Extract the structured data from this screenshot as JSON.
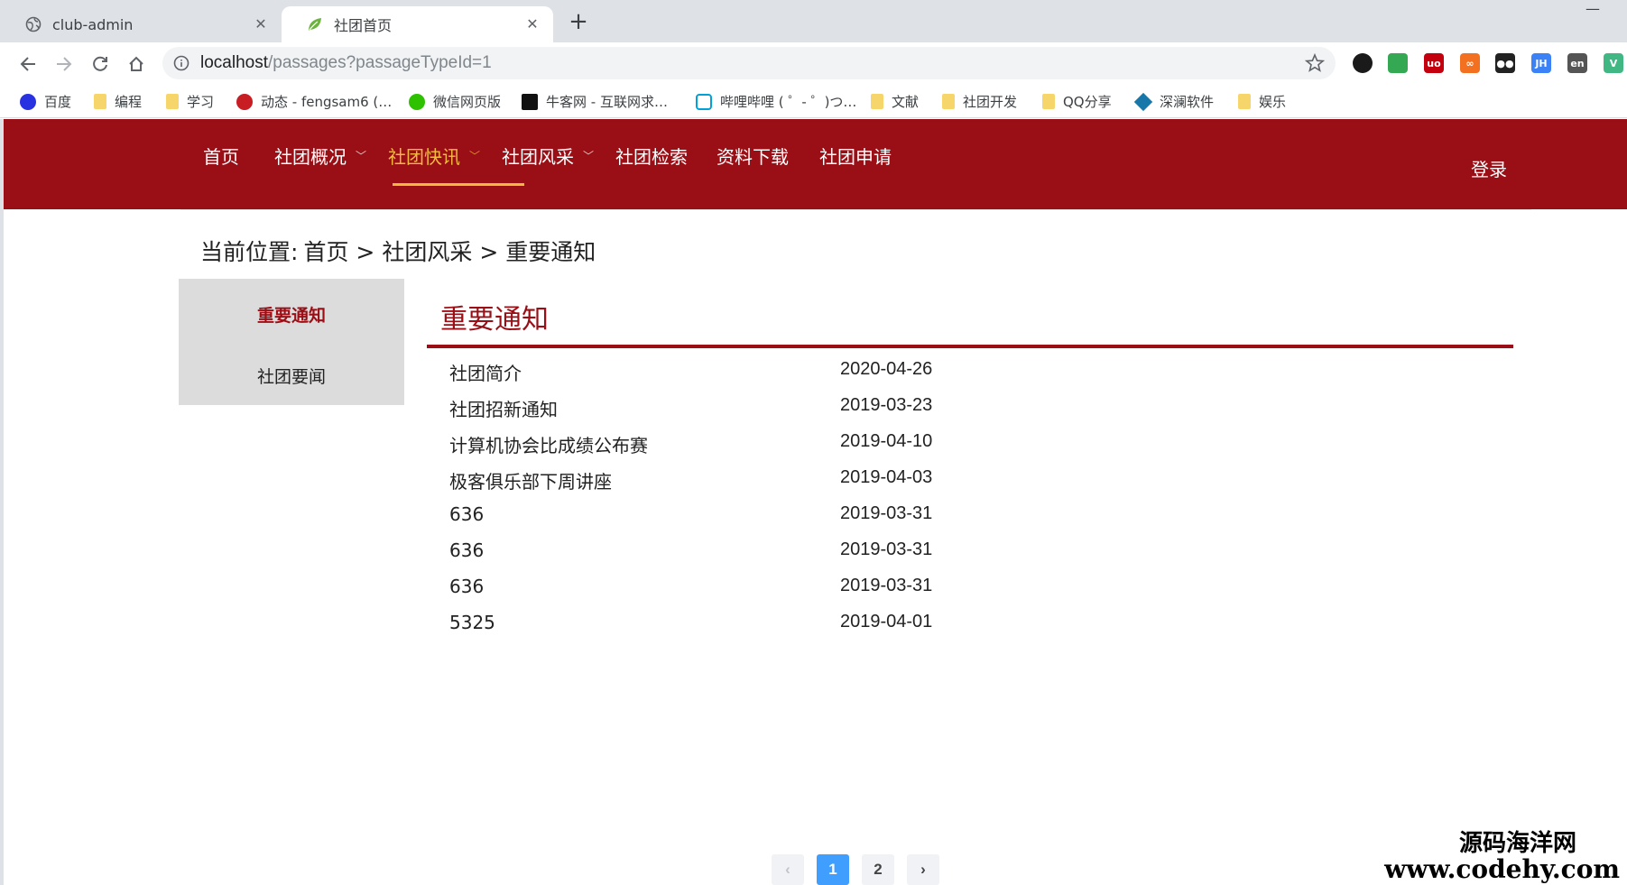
{
  "browser": {
    "tabs": [
      {
        "title": "club-admin",
        "icon": "globe-icon"
      },
      {
        "title": "社团首页",
        "icon": "spring-leaf-icon"
      }
    ],
    "url": {
      "host": "localhost",
      "path": "/passages?passageTypeId=1"
    },
    "bookmarks": [
      {
        "label": "百度",
        "icon": "baidu-paw-icon"
      },
      {
        "label": "编程",
        "icon": "folder-icon"
      },
      {
        "label": "学习",
        "icon": "folder-icon"
      },
      {
        "label": "动态 - fengsam6 (…",
        "icon": "gitee-icon"
      },
      {
        "label": "微信网页版",
        "icon": "wechat-icon"
      },
      {
        "label": "牛客网 - 互联网求…",
        "icon": "nowcoder-icon"
      },
      {
        "label": "哔哩哔哩 ( ゜- ゜)つ…",
        "icon": "bilibili-icon"
      },
      {
        "label": "文献",
        "icon": "folder-icon"
      },
      {
        "label": "社团开发",
        "icon": "folder-icon"
      },
      {
        "label": "QQ分享",
        "icon": "folder-icon"
      },
      {
        "label": "深澜软件",
        "icon": "srun-icon"
      },
      {
        "label": "娱乐",
        "icon": "folder-icon"
      }
    ],
    "extensions": [
      {
        "name": "color-picker-extension-icon",
        "color": "#1a1a1a",
        "text": ""
      },
      {
        "name": "chrome-extension-icon",
        "color": "#34a853",
        "text": ""
      },
      {
        "name": "ublock-extension-icon",
        "color": "#c4000f",
        "text": "uo"
      },
      {
        "name": "infinity-extension-icon",
        "color": "#f37021",
        "text": "∞"
      },
      {
        "name": "tampermonkey-extension-icon",
        "color": "#222222",
        "text": "●●"
      },
      {
        "name": "jh-extension-icon",
        "color": "#3b82f6",
        "text": "JH"
      },
      {
        "name": "translate-extension-icon",
        "color": "#555555",
        "text": "en"
      },
      {
        "name": "vue-devtools-extension-icon",
        "color": "#41b883",
        "text": "V"
      }
    ]
  },
  "nav": {
    "items": [
      {
        "label": "首页",
        "dropdown": false,
        "active": false
      },
      {
        "label": "社团概况",
        "dropdown": true,
        "active": false
      },
      {
        "label": "社团快讯",
        "dropdown": true,
        "active": true
      },
      {
        "label": "社团风采",
        "dropdown": true,
        "active": false
      },
      {
        "label": "社团检索",
        "dropdown": false,
        "active": false
      },
      {
        "label": "资料下载",
        "dropdown": false,
        "active": false
      },
      {
        "label": "社团申请",
        "dropdown": false,
        "active": false
      }
    ],
    "login": "登录"
  },
  "breadcrumb": {
    "prefix": "当前位置:",
    "parts": [
      "首页 >",
      "社团风采",
      "> 重要通知"
    ]
  },
  "sidebar": {
    "items": [
      {
        "label": "重要通知",
        "current": true
      },
      {
        "label": "社团要闻",
        "current": false
      }
    ]
  },
  "section": {
    "title": "重要通知"
  },
  "passages": [
    {
      "title": "社团简介",
      "date": "2020-04-26"
    },
    {
      "title": "社团招新通知",
      "date": "2019-03-23"
    },
    {
      "title": "计算机协会比成绩公布赛",
      "date": "2019-04-10"
    },
    {
      "title": "极客俱乐部下周讲座",
      "date": "2019-04-03"
    },
    {
      "title": "636",
      "date": "2019-03-31"
    },
    {
      "title": "636",
      "date": "2019-03-31"
    },
    {
      "title": "636",
      "date": "2019-03-31"
    },
    {
      "title": "5325",
      "date": "2019-04-01"
    }
  ],
  "pagination": {
    "prev": "‹",
    "pages": [
      "1",
      "2"
    ],
    "current": "1",
    "next": "›"
  },
  "watermark": {
    "line1": "源码海洋网",
    "line2": "www.codehy.com"
  },
  "colors": {
    "brand": "#9a0e15",
    "active_nav": "#f5b942",
    "pager_active": "#409eff"
  }
}
